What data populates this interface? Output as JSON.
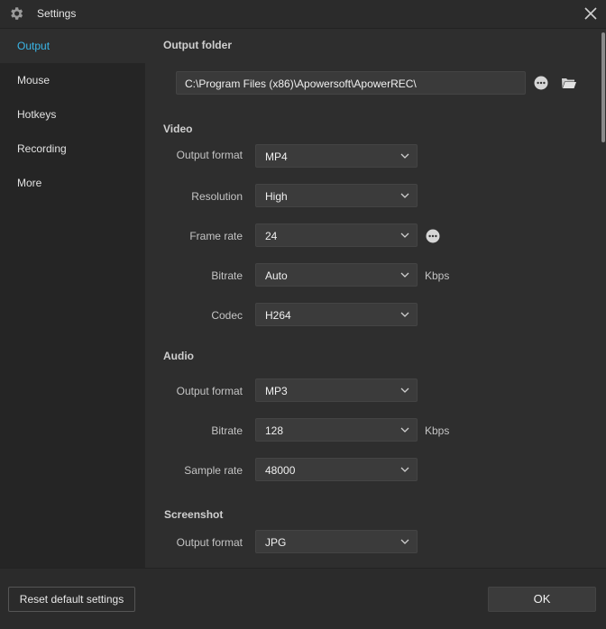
{
  "window": {
    "title": "Settings",
    "icon": "gear-icon",
    "close_icon": "close-icon"
  },
  "sidebar": {
    "items": [
      {
        "label": "Output",
        "active": true
      },
      {
        "label": "Mouse",
        "active": false
      },
      {
        "label": "Hotkeys",
        "active": false
      },
      {
        "label": "Recording",
        "active": false
      },
      {
        "label": "More",
        "active": false
      }
    ]
  },
  "output_folder": {
    "title": "Output folder",
    "path": "C:\\Program Files (x86)\\Apowersoft\\ApowerREC\\"
  },
  "video": {
    "title": "Video",
    "output_format": {
      "label": "Output format",
      "value": "MP4"
    },
    "resolution": {
      "label": "Resolution",
      "value": "High"
    },
    "frame_rate": {
      "label": "Frame rate",
      "value": "24"
    },
    "bitrate": {
      "label": "Bitrate",
      "value": "Auto",
      "unit": "Kbps"
    },
    "codec": {
      "label": "Codec",
      "value": "H264"
    }
  },
  "audio": {
    "title": "Audio",
    "output_format": {
      "label": "Output format",
      "value": "MP3"
    },
    "bitrate": {
      "label": "Bitrate",
      "value": "128",
      "unit": "Kbps"
    },
    "sample_rate": {
      "label": "Sample rate",
      "value": "48000"
    }
  },
  "screenshot": {
    "title": "Screenshot",
    "output_format": {
      "label": "Output format",
      "value": "JPG"
    }
  },
  "footer": {
    "reset_label": "Reset default settings",
    "ok_label": "OK"
  },
  "colors": {
    "accent": "#3ab7e9",
    "background": "#2e2e2e",
    "sidebar": "#252525",
    "field": "#3b3b3b"
  }
}
